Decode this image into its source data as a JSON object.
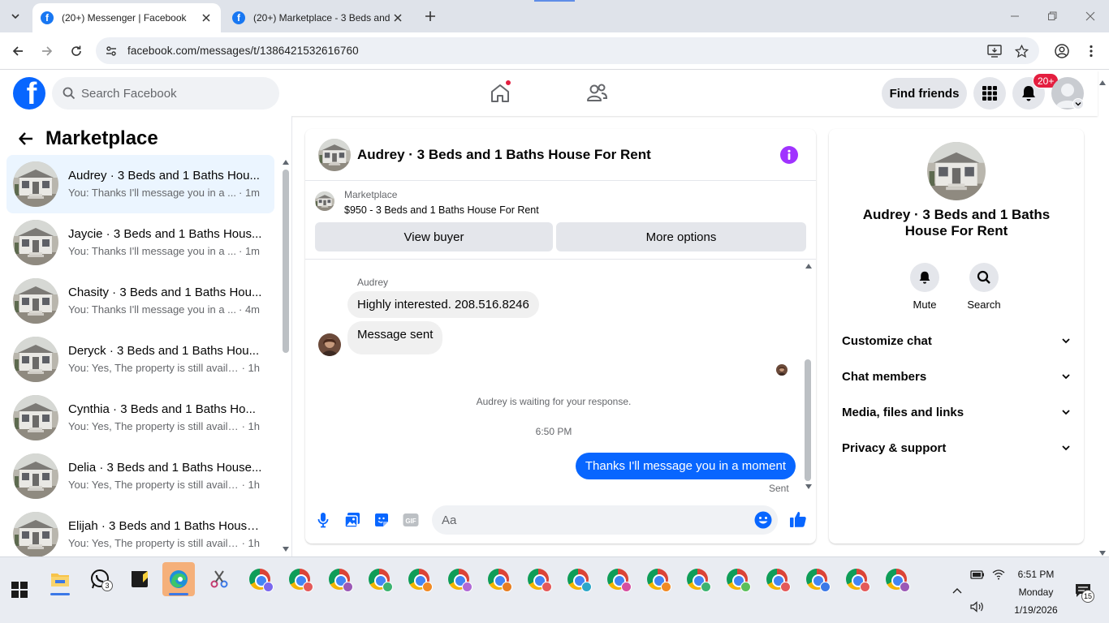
{
  "browser": {
    "tabs": [
      {
        "title": "(20+) Messenger | Facebook",
        "active": true
      },
      {
        "title": "(20+) Marketplace - 3 Beds and",
        "active": false
      }
    ],
    "url": "facebook.com/messages/t/1386421532616760"
  },
  "fb_header": {
    "logo": "f",
    "search_placeholder": "Search Facebook",
    "find_friends_label": "Find friends",
    "notification_count": "20+",
    "brand_color": "#0866ff"
  },
  "sidebar": {
    "title": "Marketplace",
    "conversations": [
      {
        "name": "Audrey · 3 Beds and 1 Baths Hou...",
        "snippet": "You: Thanks I'll message you in a ...",
        "time": "· 1m",
        "active": true
      },
      {
        "name": "Jaycie · 3 Beds and 1 Baths Hous...",
        "snippet": "You: Thanks I'll message you in a ...",
        "time": "· 1m",
        "active": false
      },
      {
        "name": "Chasity · 3 Beds and 1 Baths Hou...",
        "snippet": "You: Thanks I'll message you in a ...",
        "time": "· 4m",
        "active": false
      },
      {
        "name": "Deryck · 3 Beds and 1 Baths Hou...",
        "snippet": "You: Yes, The property is still availa...",
        "time": "· 1h",
        "active": false
      },
      {
        "name": "Cynthia · 3 Beds and 1 Baths Ho...",
        "snippet": "You: Yes, The property is still availa...",
        "time": "· 1h",
        "active": false
      },
      {
        "name": "Delia · 3 Beds and 1 Baths House...",
        "snippet": "You: Yes, The property is still availa...",
        "time": "· 1h",
        "active": false
      },
      {
        "name": "Elijah · 3 Beds and 1 Baths House...",
        "snippet": "You: Yes, The property is still availa...",
        "time": "· 1h",
        "active": false
      }
    ]
  },
  "chat": {
    "title": "Audrey · 3 Beds and 1 Baths House For Rent",
    "listing_label": "Marketplace",
    "listing_title": "$950 - 3 Beds and 1 Baths House For Rent",
    "view_buyer_label": "View buyer",
    "more_options_label": "More options",
    "sender_name": "Audrey",
    "incoming": [
      "Highly interested. 208.516.8246",
      "Message sent"
    ],
    "waiting_note": "Audrey is waiting for your response.",
    "timestamp": "6:50 PM",
    "outgoing": "Thanks I'll message you in a moment",
    "sent_status": "Sent",
    "composer_placeholder": "Aa",
    "accent_color": "#0866ff"
  },
  "info_panel": {
    "name": "Audrey · 3 Beds and 1 Baths House For Rent",
    "actions": [
      {
        "label": "Mute",
        "icon": "bell-icon"
      },
      {
        "label": "Search",
        "icon": "search-icon"
      }
    ],
    "sections": [
      "Customize chat",
      "Chat members",
      "Media, files and links",
      "Privacy & support"
    ]
  },
  "taskbar": {
    "time": "6:51 PM",
    "day": "Monday",
    "date": "1/19/2026",
    "whatsapp_badge": "3",
    "notification_badge": "15"
  }
}
